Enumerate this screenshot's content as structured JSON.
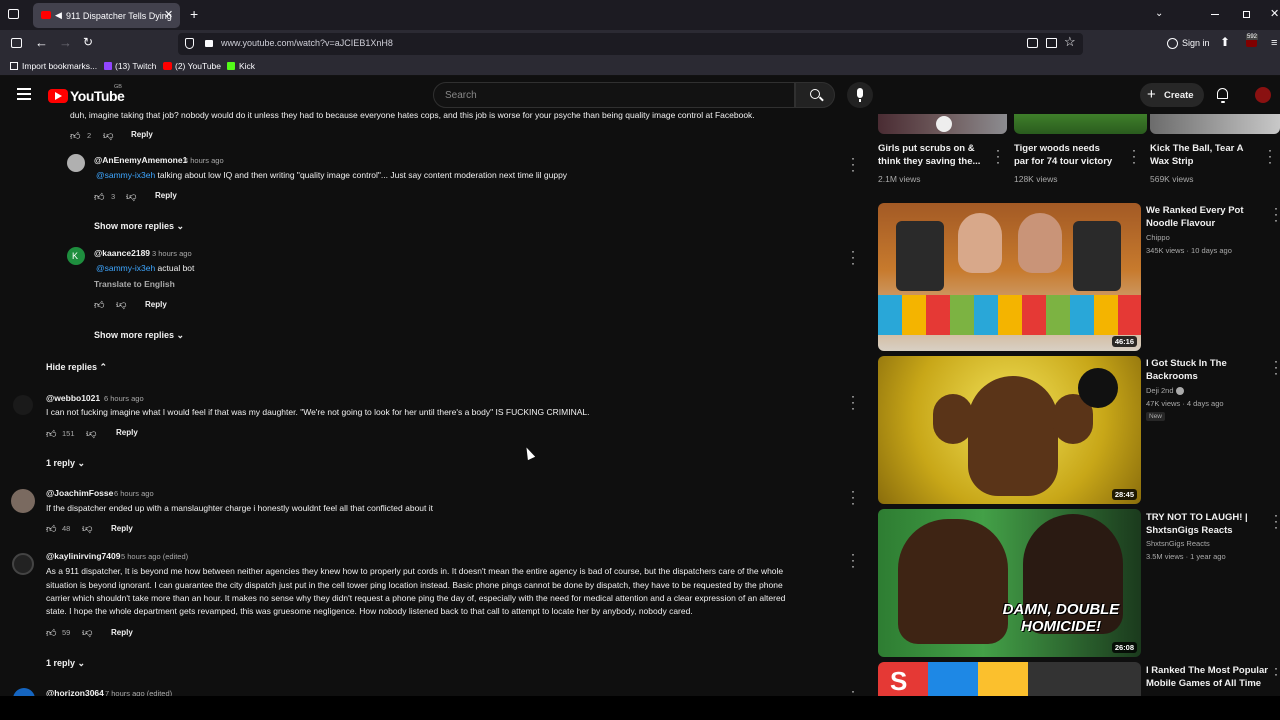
{
  "browser": {
    "tab_title": "911 Dispatcher Tells Dying",
    "url": "www.youtube.com/watch?v=aJCIEB1XnH8",
    "sign_in": "Sign in",
    "bookmarks": [
      {
        "label": "Import bookmarks..."
      },
      {
        "label": "(13) Twitch"
      },
      {
        "label": "(2) YouTube"
      },
      {
        "label": "Kick"
      }
    ],
    "badge_count": "592"
  },
  "header": {
    "logo_text": "YouTube",
    "country": "GB",
    "search_placeholder": "Search",
    "create_label": "Create"
  },
  "comments": {
    "top_cut_text": "duh, imagine taking that job? nobody would do it unless they had to because everyone hates cops, and this job is worse for your psyche than being quality image control at Facebook.",
    "top_cut_likes": "2",
    "reply_label": "Reply",
    "reply1": {
      "handle": "@AnEnemyAmemone1",
      "time": "4 hours ago",
      "mention": "@sammy-ix3eh",
      "text": " talking about low IQ and then writing \"quality image control\"... Just say content moderation next time lil guppy",
      "likes": "3"
    },
    "show_more_1": "Show more replies",
    "reply2": {
      "handle": "@kaance2189",
      "time": "3 hours ago",
      "mention": "@sammy-ix3eh",
      "text": " actual bot",
      "translate": "Translate to English",
      "avatar_letter": "K"
    },
    "show_more_2": "Show more replies",
    "hide_replies": "Hide replies",
    "c1": {
      "handle": "@webbo1021",
      "time": "6 hours ago",
      "text": "I can not fucking imagine what I would feel if that was my daughter. \"We're not going to look for her until there's a body\" IS FUCKING CRIMINAL.",
      "likes": "151",
      "replies": "1 reply"
    },
    "c2": {
      "handle": "@JoachimFosse",
      "time": "6 hours ago",
      "text": "If the dispatcher ended up with a manslaughter charge i honestly wouldnt feel all that conflicted about it",
      "likes": "48"
    },
    "c3": {
      "handle": "@kaylinirving7409",
      "time": "5 hours ago (edited)",
      "line1": "As a 911 dispatcher, It is beyond me how between neither agencies they knew how to properly put cords in. It doesn't mean the entire agency is bad of course, but the dispatchers care of the whole",
      "line2": "situation is beyond ignorant. I can guarantee the city dispatch just put in the cell tower ping location instead. Basic phone pings cannot be done by dispatch, they have to be requested by the phone",
      "line3": "carrier which shouldn't take more than an hour. It makes no sense why they didn't request a phone ping the day of, especially with the need for medical attention and a clear expression of an altered",
      "line4": "state. I hope the whole department gets revamped, this was gruesome negligence. How nobody listened back to that call to attempt to locate her by anybody, nobody cared.",
      "likes": "59",
      "replies": "1 reply"
    },
    "c4": {
      "handle": "@horizon3064",
      "time": "7 hours ago (edited)"
    }
  },
  "shorts": [
    {
      "title_1": "Girls put scrubs on &",
      "title_2": "think they saving the...",
      "views": "2.1M views"
    },
    {
      "title_1": "Tiger woods needs",
      "title_2": "par for 74 tour victory",
      "views": "128K views"
    },
    {
      "title_1": "Kick The Ball, Tear A",
      "title_2": "Wax Strip",
      "views": "569K views"
    }
  ],
  "videos": [
    {
      "title_1": "We Ranked Every Pot",
      "title_2": "Noodle Flavour",
      "channel": "Chippo",
      "meta": "345K views · 10 days ago",
      "duration": "46:16"
    },
    {
      "title_1": "I Got Stuck In The",
      "title_2": "Backrooms",
      "channel": "Deji 2nd",
      "meta": "47K views · 4 days ago",
      "badge": "New",
      "duration": "28:45"
    },
    {
      "title_1": "TRY NOT TO LAUGH! |",
      "title_2": "ShxtsnGigs Reacts",
      "channel": "ShxtsnGigs Reacts",
      "meta": "3.5M views · 1 year ago",
      "duration": "26:08",
      "thumb_text_1": "DAMN, DOUBLE",
      "thumb_text_2": "HOMICIDE!"
    },
    {
      "title_1": "I Ranked The Most Popular",
      "title_2": "Mobile Games of All Time"
    }
  ]
}
